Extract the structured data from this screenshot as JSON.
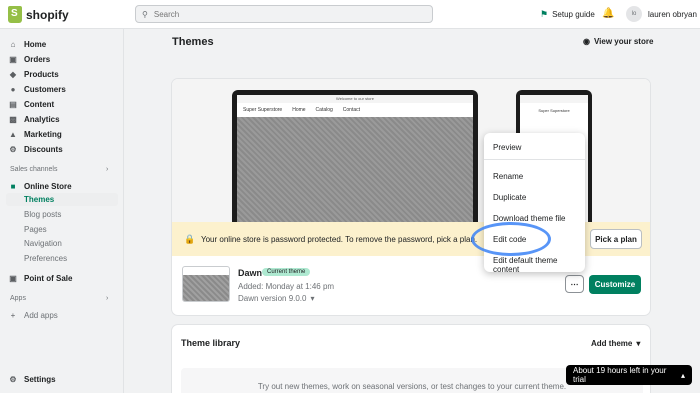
{
  "topbar": {
    "brand": "shopify",
    "search_placeholder": "Search",
    "setup_guide": "Setup guide",
    "user_initials": "lo",
    "user_name": "lauren obryan"
  },
  "sidebar": {
    "items": [
      {
        "label": "Home",
        "icon": "home-icon"
      },
      {
        "label": "Orders",
        "icon": "orders-icon"
      },
      {
        "label": "Products",
        "icon": "tag-icon"
      },
      {
        "label": "Customers",
        "icon": "person-icon"
      },
      {
        "label": "Content",
        "icon": "content-icon"
      },
      {
        "label": "Analytics",
        "icon": "analytics-icon"
      },
      {
        "label": "Marketing",
        "icon": "marketing-icon"
      },
      {
        "label": "Discounts",
        "icon": "discount-icon"
      }
    ],
    "sales_channels_label": "Sales channels",
    "online_store": "Online Store",
    "online_store_sub": [
      "Themes",
      "Blog posts",
      "Pages",
      "Navigation",
      "Preferences"
    ],
    "point_of_sale": "Point of Sale",
    "apps_label": "Apps",
    "add_apps": "Add apps",
    "settings": "Settings"
  },
  "main": {
    "title": "Themes",
    "view_store": "View your store",
    "preview": {
      "announcement": "Welcome to our store",
      "store_name": "Super Superstore",
      "nav": [
        "Home",
        "Catalog",
        "Contact"
      ]
    },
    "banner": {
      "text": "Your online store is password protected. To remove the password, pick a plan.",
      "button": "Pick a plan"
    },
    "theme": {
      "name": "Dawn",
      "badge": "Current theme",
      "added": "Added: Monday at 1:46 pm",
      "version": "Dawn version 9.0.0",
      "customize": "Customize"
    },
    "menu": {
      "items": [
        "Preview",
        "Rename",
        "Duplicate",
        "Download theme file",
        "Edit code",
        "Edit default theme content"
      ]
    },
    "library": {
      "title": "Theme library",
      "add_theme": "Add theme",
      "text": "Try out new themes, work on seasonal versions, or test changes to your current theme."
    }
  },
  "trial": {
    "text": "About 19 hours left in your trial"
  },
  "colors": {
    "accent": "#008060",
    "banner": "#fcf1cd",
    "highlight": "#3b82f6"
  }
}
